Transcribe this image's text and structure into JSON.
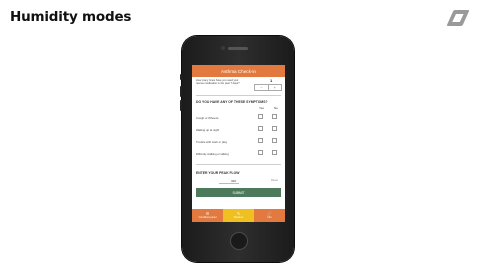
{
  "slide": {
    "title": "Humidity modes"
  },
  "app": {
    "title": "Asthma Check-in",
    "question1": {
      "text": "How many times have you used your rescue medication in the past 7 days?",
      "value": "1",
      "minus": "−",
      "plus": "+"
    },
    "symptoms": {
      "heading": "DO YOU HAVE ANY OF THESE SYMPTOMS?",
      "col_yes": "Yes",
      "col_no": "No",
      "items": [
        "Cough or Wheeze",
        "Waking up at night",
        "Trouble with work or play",
        "Difficulty walking or talking"
      ]
    },
    "peak_flow": {
      "heading": "ENTER YOUR PEAK FLOW",
      "value": "320",
      "reset": "Reset"
    },
    "submit_label": "SUBMIT",
    "tabs": [
      {
        "label": "Conditions panel",
        "icon": "list-icon",
        "color": "#e2793e"
      },
      {
        "label": "Check-in",
        "icon": "pencil-icon",
        "color": "#f0c020"
      },
      {
        "label": "Info",
        "icon": "link-icon",
        "color": "#e2793e"
      }
    ]
  },
  "colors": {
    "accent": "#e2793e",
    "submit": "#4d7a5a",
    "tab_active": "#f0c020"
  }
}
